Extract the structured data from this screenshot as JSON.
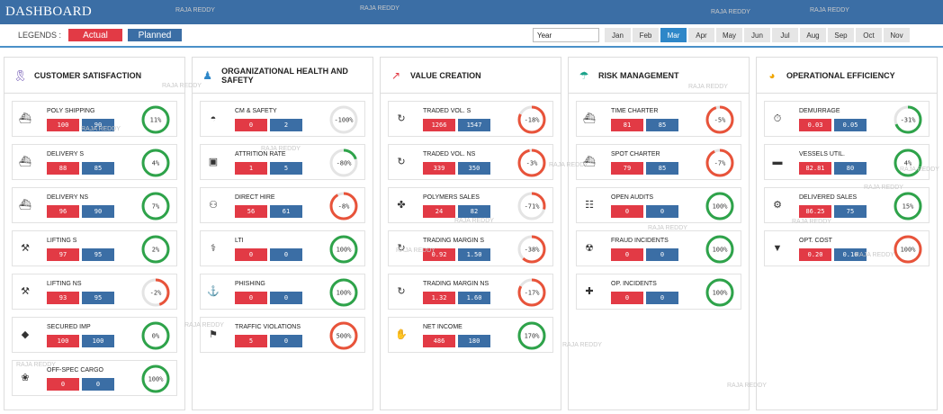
{
  "header": {
    "title": "DASHBOARD"
  },
  "filters": {
    "legends_label": "LEGENDS :",
    "actual_label": "Actual",
    "planned_label": "Planned",
    "year_label": "Year",
    "months": [
      "Jan",
      "Feb",
      "Mar",
      "Apr",
      "May",
      "Jun",
      "Jul",
      "Aug",
      "Sep",
      "Oct",
      "Nov"
    ],
    "selected_month": "Mar"
  },
  "colors": {
    "actual": "#e23a45",
    "planned": "#3b6ea5",
    "ring_good": "#2ea34a",
    "ring_bad": "#e8533a",
    "ring_track": "#e4e4e4"
  },
  "watermark": "RAJA REDDY",
  "sections": [
    {
      "title": "CUSTOMER SATISFACTION",
      "icon": "ribbon-icon",
      "icon_color": "#6a4fb0",
      "kpis": [
        {
          "name": "POLY SHIPPING",
          "icon": "ship-icon",
          "actual": "100",
          "planned": "90",
          "pct": "11%",
          "status": "good",
          "fill": 1
        },
        {
          "name": "DELIVERY S",
          "icon": "ship-clock-icon",
          "actual": "88",
          "planned": "85",
          "pct": "4%",
          "status": "good",
          "fill": 1
        },
        {
          "name": "DELIVERY NS",
          "icon": "ship-icon",
          "actual": "96",
          "planned": "90",
          "pct": "7%",
          "status": "good",
          "fill": 1
        },
        {
          "name": "LIFTING S",
          "icon": "crane-icon",
          "actual": "97",
          "planned": "95",
          "pct": "2%",
          "status": "good",
          "fill": 1
        },
        {
          "name": "LIFTING NS",
          "icon": "crane-icon",
          "actual": "93",
          "planned": "95",
          "pct": "-2%",
          "status": "bad",
          "fill": 0.45
        },
        {
          "name": "SECURED IMP",
          "icon": "shield-icon",
          "actual": "100",
          "planned": "100",
          "pct": "0%",
          "status": "good",
          "fill": 1
        },
        {
          "name": "OFF-SPEC CARGO",
          "icon": "award-icon",
          "actual": "0",
          "planned": "0",
          "pct": "100%",
          "status": "good",
          "fill": 1
        }
      ]
    },
    {
      "title": "ORGANIZATIONAL HEALTH AND SAFETY",
      "icon": "worker-icon",
      "icon_color": "#2e87c8",
      "kpis": [
        {
          "name": "CM & SAFETY",
          "icon": "helmet-icon",
          "actual": "0",
          "planned": "2",
          "pct": "-100%",
          "status": "neutral",
          "fill": 0
        },
        {
          "name": "ATTRITION RATE",
          "icon": "briefcase-icon",
          "actual": "1",
          "planned": "5",
          "pct": "-80%",
          "status": "good",
          "fill": 0.2
        },
        {
          "name": "DIRECT HIRE",
          "icon": "people-icon",
          "actual": "56",
          "planned": "61",
          "pct": "-8%",
          "status": "bad",
          "fill": 0.92
        },
        {
          "name": "LTI",
          "icon": "injury-icon",
          "actual": "0",
          "planned": "0",
          "pct": "100%",
          "status": "good",
          "fill": 1
        },
        {
          "name": "PHISHING",
          "icon": "hook-icon",
          "actual": "0",
          "planned": "0",
          "pct": "100%",
          "status": "good",
          "fill": 1
        },
        {
          "name": "TRAFFIC VIOLATIONS",
          "icon": "traffic-icon",
          "actual": "5",
          "planned": "0",
          "pct": "500%",
          "status": "bad",
          "fill": 1
        }
      ]
    },
    {
      "title": "VALUE CREATION",
      "icon": "chart-up-icon",
      "icon_color": "#e23a45",
      "kpis": [
        {
          "name": "TRADED VOL. S",
          "icon": "money-cycle-icon",
          "actual": "1266",
          "planned": "1547",
          "pct": "-18%",
          "status": "bad",
          "fill": 0.82
        },
        {
          "name": "TRADED VOL. NS",
          "icon": "money-cycle-icon",
          "actual": "339",
          "planned": "350",
          "pct": "-3%",
          "status": "bad",
          "fill": 0.97
        },
        {
          "name": "POLYMERS SALES",
          "icon": "molecule-icon",
          "actual": "24",
          "planned": "82",
          "pct": "-71%",
          "status": "bad",
          "fill": 0.29
        },
        {
          "name": "TRADING MARGIN S",
          "icon": "money-cycle-icon",
          "actual": "0.92",
          "planned": "1.50",
          "pct": "-38%",
          "status": "bad",
          "fill": 0.62
        },
        {
          "name": "TRADING MARGIN NS",
          "icon": "money-cycle-icon",
          "actual": "1.32",
          "planned": "1.60",
          "pct": "-17%",
          "status": "bad",
          "fill": 0.83
        },
        {
          "name": "NET INCOME",
          "icon": "hand-coins-icon",
          "actual": "486",
          "planned": "180",
          "pct": "170%",
          "status": "good",
          "fill": 1
        }
      ]
    },
    {
      "title": "RISK MANAGEMENT",
      "icon": "umbrella-icon",
      "icon_color": "#1aa38a",
      "kpis": [
        {
          "name": "TIME CHARTER",
          "icon": "ship-icon",
          "actual": "81",
          "planned": "85",
          "pct": "-5%",
          "status": "bad",
          "fill": 0.95
        },
        {
          "name": "SPOT CHARTER",
          "icon": "ship-icon",
          "actual": "79",
          "planned": "85",
          "pct": "-7%",
          "status": "bad",
          "fill": 0.93
        },
        {
          "name": "OPEN AUDITS",
          "icon": "audit-icon",
          "actual": "0",
          "planned": "0",
          "pct": "100%",
          "status": "good",
          "fill": 1
        },
        {
          "name": "FRAUD INCIDENTS",
          "icon": "fraud-icon",
          "actual": "0",
          "planned": "0",
          "pct": "100%",
          "status": "good",
          "fill": 1
        },
        {
          "name": "OP. INCIDENTS",
          "icon": "incident-icon",
          "actual": "0",
          "planned": "0",
          "pct": "100%",
          "status": "good",
          "fill": 1
        }
      ]
    },
    {
      "title": "OPERATIONAL EFFICIENCY",
      "icon": "speedometer-icon",
      "icon_color": "#f0a500",
      "kpis": [
        {
          "name": "DEMURRAGE",
          "icon": "stopwatch-icon",
          "actual": "0.03",
          "planned": "0.05",
          "pct": "-31%",
          "status": "good",
          "fill": 0.69
        },
        {
          "name": "VESSELS UTIL.",
          "icon": "vessel-icon",
          "actual": "82.81",
          "planned": "80",
          "pct": "4%",
          "status": "good",
          "fill": 1
        },
        {
          "name": "DELIVERED SALES",
          "icon": "gear-icon",
          "actual": "86.25",
          "planned": "75",
          "pct": "15%",
          "status": "good",
          "fill": 1
        },
        {
          "name": "OPT. COST",
          "icon": "cost-icon",
          "actual": "0.20",
          "planned": "0.10",
          "pct": "100%",
          "status": "bad",
          "fill": 1
        }
      ]
    }
  ]
}
